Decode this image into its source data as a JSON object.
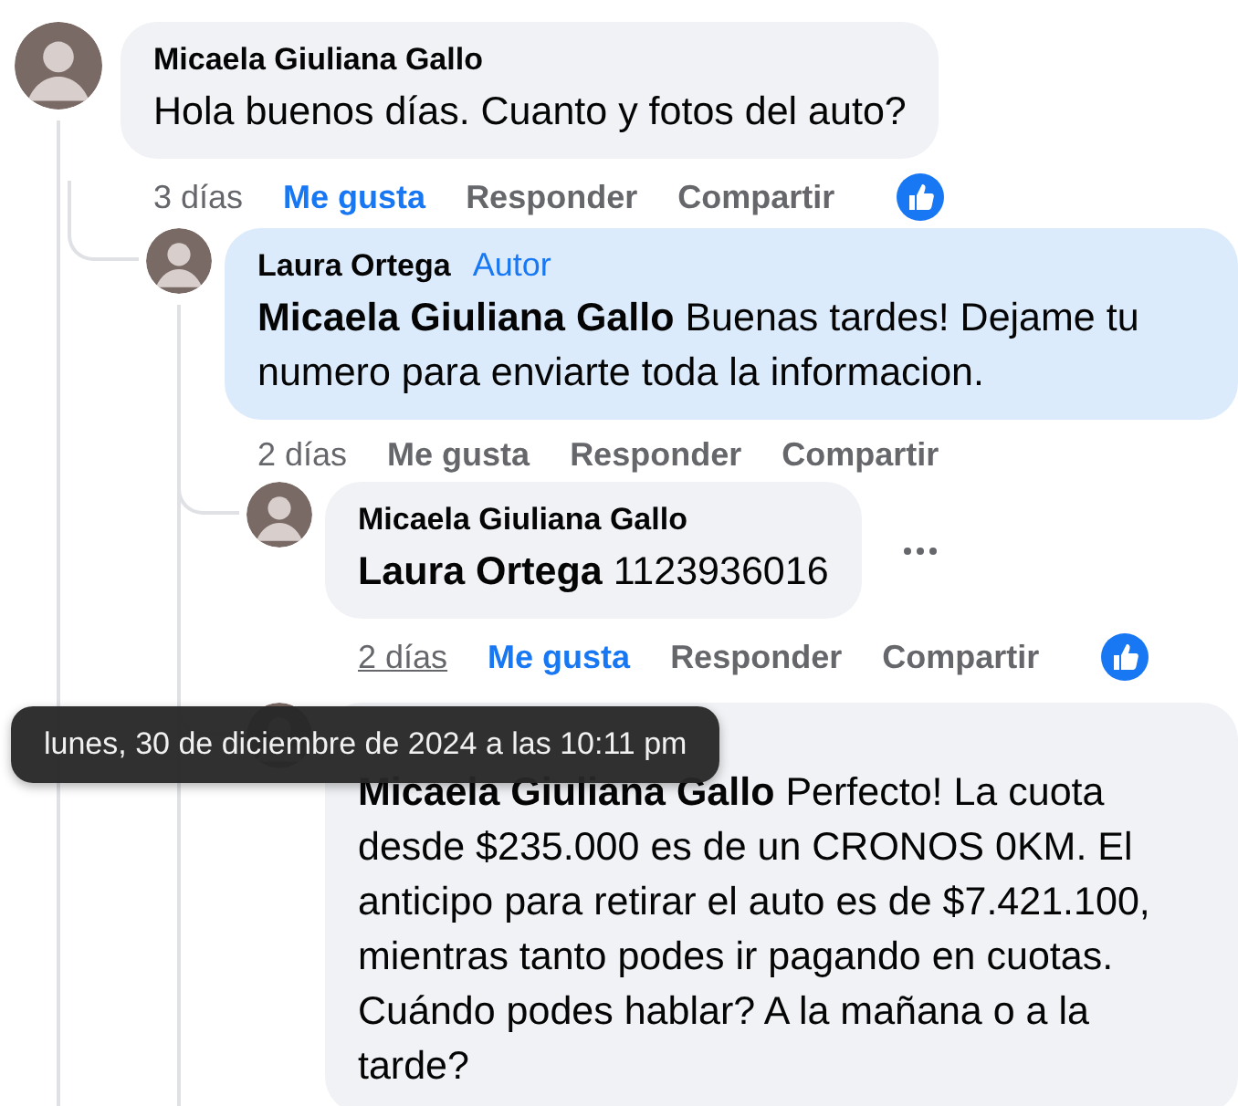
{
  "comments": [
    {
      "author": "Micaela Giuliana Gallo",
      "text": "Hola buenos días. Cuanto y fotos del auto?",
      "highlighted": false,
      "actions": {
        "time": "3 días",
        "time_hovered": false,
        "like": "Me gusta",
        "liked": true,
        "reply": "Responder",
        "share": "Compartir",
        "reaction": true
      },
      "children": [
        {
          "author": "Laura Ortega",
          "badge": "Autor",
          "mention": "Micaela Giuliana Gallo",
          "text": "Buenas tardes! Dejame tu numero para enviarte toda la informacion.",
          "highlighted": true,
          "actions": {
            "time": "2 días",
            "time_hovered": false,
            "like": "Me gusta",
            "liked": false,
            "reply": "Responder",
            "share": "Compartir",
            "reaction": false
          },
          "children": [
            {
              "author": "Micaela Giuliana Gallo",
              "mention": "Laura Ortega",
              "text": "1123936016",
              "highlighted": false,
              "more_button": true,
              "actions": {
                "time": "2 días",
                "time_hovered": true,
                "like": "Me gusta",
                "liked": true,
                "reply": "Responder",
                "share": "Compartir",
                "reaction": true
              }
            },
            {
              "mention": "Micaela Giuliana Gallo",
              "text": "Perfecto! La cuota desde $235.000 es de un CRONOS 0KM. El anticipo para retirar el auto es de $7.421.100, mientras tanto podes ir pagando en cuotas. Cuándo podes hablar? A la mañana o a la tarde?",
              "highlighted": false
            }
          ]
        }
      ]
    }
  ],
  "tooltip": "lunes, 30 de diciembre de 2024 a las 10:11 pm"
}
